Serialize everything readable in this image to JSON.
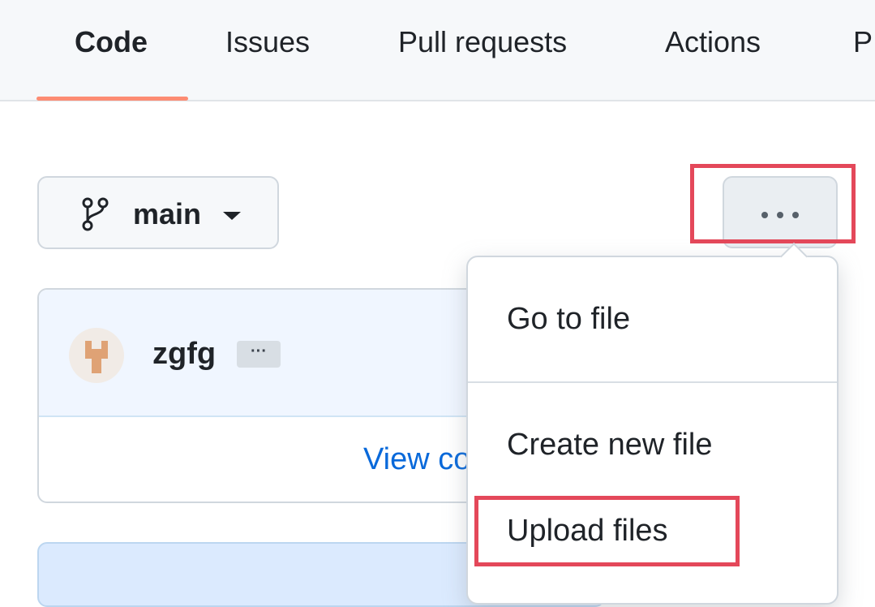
{
  "tabs": [
    {
      "label": "Code",
      "active": true
    },
    {
      "label": "Issues"
    },
    {
      "label": "Pull requests"
    },
    {
      "label": "Actions"
    },
    {
      "label": "P"
    }
  ],
  "branch": {
    "name": "main",
    "icon": "git-branch-icon"
  },
  "more_button": {
    "icon": "kebab-horizontal-icon"
  },
  "commit": {
    "author": "zgfg",
    "ellipsis": "···",
    "view_code_text": "View co"
  },
  "menu": {
    "items": [
      {
        "label": "Go to file"
      },
      {
        "label": "Create new file"
      },
      {
        "label": "Upload files"
      }
    ]
  },
  "colors": {
    "highlight": "#e4485a",
    "tab_underline": "#fd8c73",
    "link": "#0969da"
  }
}
